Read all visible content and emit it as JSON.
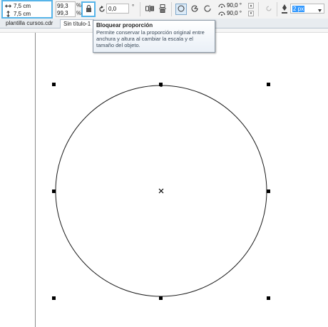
{
  "toolbar": {
    "width_value": "7,5 cm",
    "height_value": "7,5 cm",
    "scale_x": "99,3",
    "scale_y": "99,3",
    "percent_symbol": "%",
    "rotation_value": "0,0",
    "degree_symbol": "°",
    "angle_start": "90,0 °",
    "angle_end": "90,0 °",
    "outline_width": "2 px"
  },
  "tabs": [
    {
      "label": "plantilla cursos.cdr"
    },
    {
      "label": "Sin título-1"
    }
  ],
  "tooltip": {
    "title": "Bloquear proporción",
    "body": "Permite conservar la proporción original entre anchura y altura al cambiar la escala y el tamaño del objeto."
  },
  "icons": {
    "width": "width-arrows-icon",
    "height": "height-arrows-icon",
    "lock": "lock-ratio-icon",
    "rotate": "rotate-icon",
    "mirror_h": "mirror-horizontal-icon",
    "mirror_v": "mirror-vertical-icon",
    "ellipse": "ellipse-shape-icon",
    "pie": "pie-shape-icon",
    "arc": "arc-shape-icon",
    "pen": "pen-outline-icon"
  },
  "colors": {
    "highlight_border": "#56b4e9",
    "selected_text_bg": "#3399ff"
  }
}
